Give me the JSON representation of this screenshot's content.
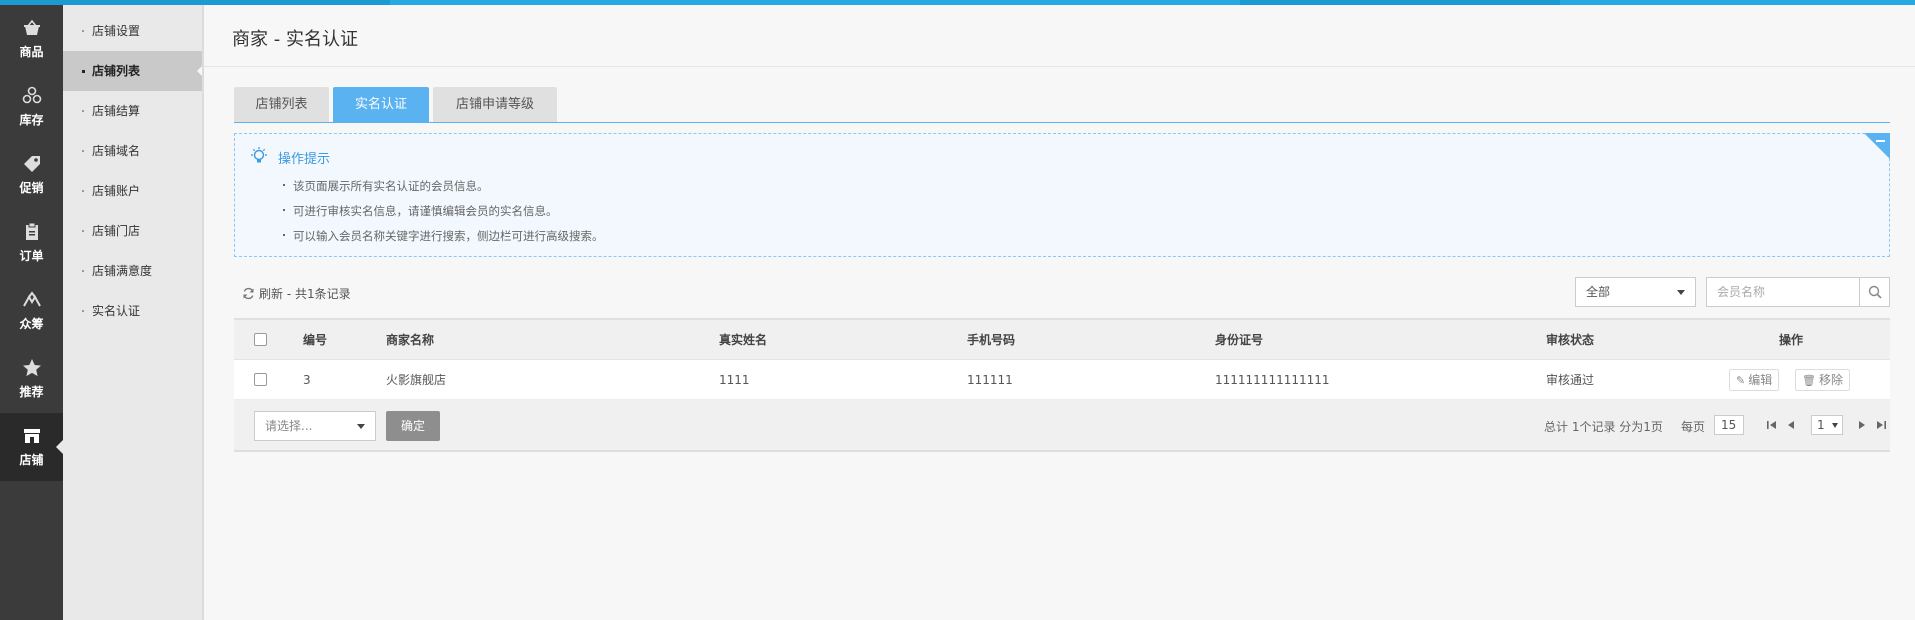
{
  "rail": {
    "items": [
      {
        "label": "商品",
        "icon": "basket-icon"
      },
      {
        "label": "库存",
        "icon": "stock-icon"
      },
      {
        "label": "促销",
        "icon": "tag-icon"
      },
      {
        "label": "订单",
        "icon": "order-icon"
      },
      {
        "label": "众筹",
        "icon": "crowdfund-icon"
      },
      {
        "label": "推荐",
        "icon": "star-icon"
      },
      {
        "label": "店铺",
        "icon": "store-icon"
      }
    ],
    "active_label": "店铺"
  },
  "subnav": {
    "items": [
      {
        "label": "店铺设置"
      },
      {
        "label": "店铺列表"
      },
      {
        "label": "店铺结算"
      },
      {
        "label": "店铺域名"
      },
      {
        "label": "店铺账户"
      },
      {
        "label": "店铺门店"
      },
      {
        "label": "店铺满意度"
      },
      {
        "label": "实名认证"
      }
    ],
    "active_label": "店铺列表"
  },
  "page": {
    "title": "商家 - 实名认证"
  },
  "tabs": [
    {
      "label": "店铺列表"
    },
    {
      "label": "实名认证"
    },
    {
      "label": "店铺申请等级"
    }
  ],
  "active_tab": "实名认证",
  "tips": {
    "title": "操作提示",
    "items": [
      "该页面展示所有实名认证的会员信息。",
      "可进行审核实名信息，请谨慎编辑会员的实名信息。",
      "可以输入会员名称关键字进行搜索，侧边栏可进行高级搜索。"
    ]
  },
  "toolbar": {
    "refresh_label": "刷新 - 共1条记录",
    "filter_value": "全部",
    "search_placeholder": "会员名称"
  },
  "table": {
    "columns": [
      "编号",
      "商家名称",
      "真实姓名",
      "手机号码",
      "身份证号",
      "审核状态",
      "操作"
    ],
    "rows": [
      {
        "id": "3",
        "shop": "火影旗舰店",
        "real_name": "1111",
        "phone": "111111",
        "id_number": "111111111111111",
        "status": "审核通过",
        "edit_label": "编辑",
        "remove_label": "移除"
      }
    ]
  },
  "footer": {
    "batch_placeholder": "请选择...",
    "confirm_label": "确定",
    "summary": "总计 1个记录 分为1页",
    "per_page_label": "每页",
    "per_page_value": "15",
    "current_page": "1"
  },
  "colors": {
    "accent": "#5ab2f0",
    "topbar": "#27a9e3",
    "rail_bg": "#3b3b3b",
    "subnav_bg": "#e9e9e9"
  }
}
